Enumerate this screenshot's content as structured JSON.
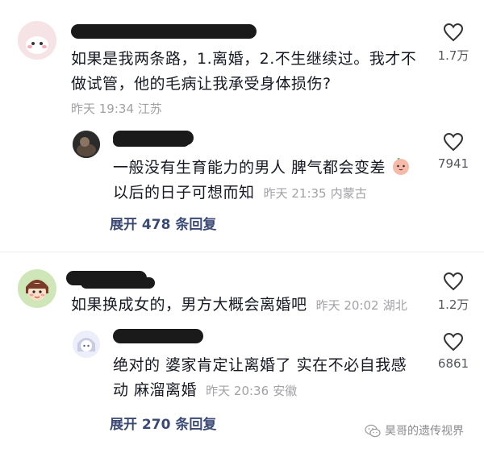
{
  "comments": [
    {
      "text_line1": "如果是我两条路，1.离婚，2.不生继续过。我才不",
      "text_line2": "做试管，他的毛病让我承受身体损伤?",
      "time": "昨天 19:34",
      "location": "江苏",
      "likes": "1.7万",
      "reply": {
        "text_line1": "一般没有生育能力的男人 脾气都会变差",
        "text_line2": "以后的日子可想而知",
        "time": "昨天 21:35",
        "location": "内蒙古",
        "likes": "7941"
      },
      "expand_label": "展开 478 条回复"
    },
    {
      "text_line1": "如果换成女的，男方大概会离婚吧",
      "time": "昨天 20:02",
      "location": "湖北",
      "likes": "1.2万",
      "reply": {
        "text_line1": "绝对的 婆家肯定让离婚了 实在不必自我感",
        "text_line2": "动 麻溜离婚",
        "time": "昨天 20:36",
        "location": "安徽",
        "likes": "6861"
      },
      "expand_label": "展开 270 条回复"
    }
  ],
  "watermark": "昊哥的遗传视界"
}
